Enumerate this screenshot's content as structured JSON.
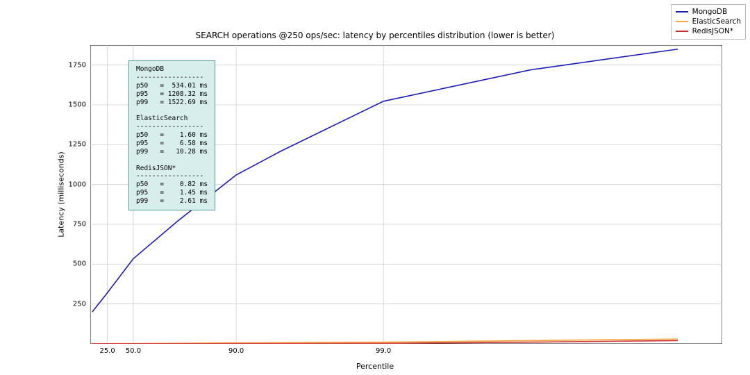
{
  "chart_data": {
    "type": "line",
    "title": "SEARCH operations @250 ops/sec: latency by percentiles distribution (lower is better)",
    "xlabel": "Percentile",
    "ylabel": "Latency (milliseconds)",
    "x_ticks": [
      25.0,
      50.0,
      90.0,
      99.0
    ],
    "ylim": [
      0,
      1875
    ],
    "y_ticks": [
      250,
      500,
      750,
      1000,
      1250,
      1500,
      1750
    ],
    "x_scale_note": "log-percentile",
    "series": [
      {
        "name": "MongoDB",
        "color": "#1c1cb8",
        "points": [
          {
            "percentile": 5,
            "latency_ms": 200
          },
          {
            "percentile": 25,
            "latency_ms": 320
          },
          {
            "percentile": 50,
            "latency_ms": 534.01
          },
          {
            "percentile": 75,
            "latency_ms": 770
          },
          {
            "percentile": 90,
            "latency_ms": 1060
          },
          {
            "percentile": 95,
            "latency_ms": 1208.32
          },
          {
            "percentile": 99,
            "latency_ms": 1522.69
          },
          {
            "percentile": 99.9,
            "latency_ms": 1720
          },
          {
            "percentile": 99.99,
            "latency_ms": 1850
          }
        ]
      },
      {
        "name": "ElasticSearch",
        "color": "#f2a73b",
        "points": [
          {
            "percentile": 5,
            "latency_ms": 0.7
          },
          {
            "percentile": 25,
            "latency_ms": 1.0
          },
          {
            "percentile": 50,
            "latency_ms": 1.6
          },
          {
            "percentile": 75,
            "latency_ms": 3.0
          },
          {
            "percentile": 90,
            "latency_ms": 5.0
          },
          {
            "percentile": 95,
            "latency_ms": 6.58
          },
          {
            "percentile": 99,
            "latency_ms": 10.28
          },
          {
            "percentile": 99.9,
            "latency_ms": 20
          },
          {
            "percentile": 99.99,
            "latency_ms": 30
          }
        ]
      },
      {
        "name": "RedisJSON*",
        "color": "#d22e2e",
        "points": [
          {
            "percentile": 5,
            "latency_ms": 0.5
          },
          {
            "percentile": 25,
            "latency_ms": 0.6
          },
          {
            "percentile": 50,
            "latency_ms": 0.82
          },
          {
            "percentile": 75,
            "latency_ms": 1.1
          },
          {
            "percentile": 90,
            "latency_ms": 1.3
          },
          {
            "percentile": 95,
            "latency_ms": 1.45
          },
          {
            "percentile": 99,
            "latency_ms": 2.61
          },
          {
            "percentile": 99.9,
            "latency_ms": 10
          },
          {
            "percentile": 99.99,
            "latency_ms": 20
          }
        ]
      }
    ]
  },
  "stats_box": {
    "lines": [
      "MongoDB",
      "-----------------",
      "p50   =  534.01 ms",
      "p95   = 1208.32 ms",
      "p99   = 1522.69 ms",
      "",
      "ElasticSearch",
      "-----------------",
      "p50   =    1.60 ms",
      "p95   =    6.58 ms",
      "p99   =   10.28 ms",
      "",
      "RedisJSON*",
      "-----------------",
      "p50   =    0.82 ms",
      "p95   =    1.45 ms",
      "p99   =    2.61 ms"
    ]
  }
}
